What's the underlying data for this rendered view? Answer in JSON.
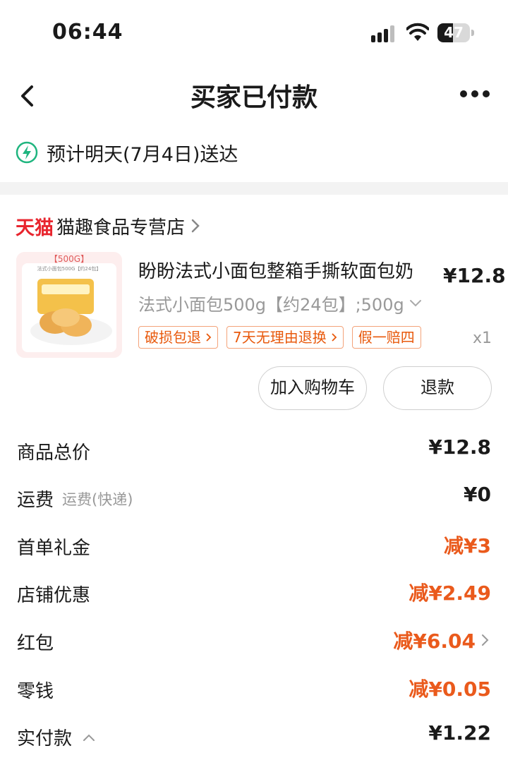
{
  "status_bar": {
    "time": "06:44",
    "battery": "47",
    "battery_level": 0.47
  },
  "nav": {
    "title": "买家已付款"
  },
  "delivery": {
    "text": "预计明天(7月4日)送达"
  },
  "store": {
    "platform": "天猫",
    "name": "猫趣食品专营店"
  },
  "product": {
    "title": "盼盼法式小面包整箱手撕软面包奶",
    "price": "¥12.8",
    "sku": "法式小面包500g【约24包】;500g",
    "image_label": "【500G】",
    "image_sublabel": "法式小面包500G【约24包】",
    "tags": [
      "破损包退",
      "7天无理由退换",
      "假一赔四"
    ],
    "quantity": "x1"
  },
  "buttons": {
    "add_to_cart": "加入购物车",
    "refund": "退款"
  },
  "summary": {
    "items": [
      {
        "label": "商品总价",
        "sub": "",
        "value": "¥12.8",
        "discount": false,
        "chevron": false
      },
      {
        "label": "运费",
        "sub": "运费(快递)",
        "value": "¥0",
        "discount": false,
        "chevron": false
      },
      {
        "label": "首单礼金",
        "sub": "",
        "value": "减¥3",
        "discount": true,
        "chevron": false
      },
      {
        "label": "店铺优惠",
        "sub": "",
        "value": "减¥2.49",
        "discount": true,
        "chevron": false
      },
      {
        "label": "红包",
        "sub": "",
        "value": "减¥6.04",
        "discount": true,
        "chevron": true
      },
      {
        "label": "零钱",
        "sub": "",
        "value": "减¥0.05",
        "discount": true,
        "chevron": false
      },
      {
        "label": "实付款",
        "sub": "",
        "value": "¥1.22",
        "discount": false,
        "chevron": false
      }
    ]
  },
  "colors": {
    "accent": "#ea5a1c",
    "tmall": "#e8252e",
    "bolt": "#1fb57f"
  }
}
